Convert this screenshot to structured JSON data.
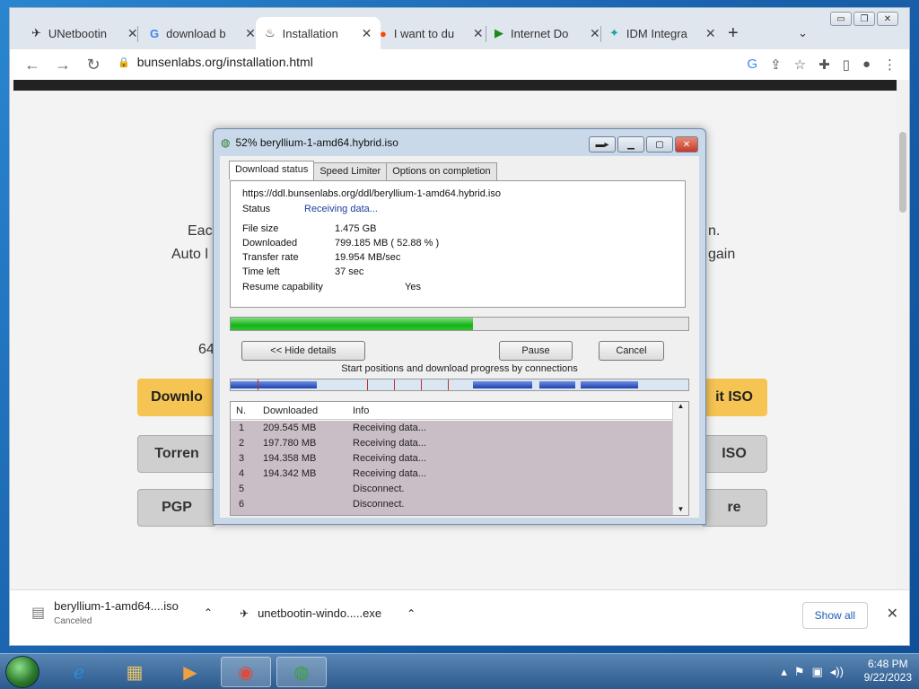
{
  "browser": {
    "tabs": [
      {
        "title": "UNetbootin",
        "icon": "unetbootin-icon"
      },
      {
        "title": "download b",
        "icon": "google-icon"
      },
      {
        "title": "Installation",
        "icon": "bunsenlabs-icon"
      },
      {
        "title": "I want to du",
        "icon": "reddit-icon"
      },
      {
        "title": "Internet Do",
        "icon": "play-icon"
      },
      {
        "title": "IDM Integra",
        "icon": "idm-integration-icon"
      }
    ],
    "url": "bunsenlabs.org/installation.html"
  },
  "page": {
    "text_left_1": "Eac",
    "text_right_1": "n.",
    "text_left_2": "Auto l",
    "text_right_2": "gain",
    "text_64": "64",
    "btn_download_left": "Downlo",
    "btn_download_right": "it ISO",
    "btn_torrent_left": "Torren",
    "btn_torrent_right": "ISO",
    "btn_pgp_left": "PGP",
    "btn_pgp_right": "re"
  },
  "idm": {
    "title": "52% beryllium-1-amd64.hybrid.iso",
    "tabs": [
      "Download status",
      "Speed Limiter",
      "Options on completion"
    ],
    "url": "https://ddl.bunsenlabs.org/ddl/beryllium-1-amd64.hybrid.iso",
    "status_label": "Status",
    "status_value": "Receiving data...",
    "file_size_label": "File size",
    "file_size": "1.475  GB",
    "downloaded_label": "Downloaded",
    "downloaded": "799.185  MB  ( 52.88 % )",
    "transfer_rate_label": "Transfer rate",
    "transfer_rate": "19.954  MB/sec",
    "time_left_label": "Time left",
    "time_left": "37 sec",
    "resume_label": "Resume capability",
    "resume": "Yes",
    "progress_fraction": 0.5288,
    "hide_details": "<< Hide details",
    "pause": "Pause",
    "cancel": "Cancel",
    "connections_label": "Start positions and download progress by connections",
    "columns": [
      "N.",
      "Downloaded",
      "Info"
    ],
    "rows": [
      {
        "n": "1",
        "downloaded": "209.545  MB",
        "info": "Receiving data..."
      },
      {
        "n": "2",
        "downloaded": "197.780  MB",
        "info": "Receiving data..."
      },
      {
        "n": "3",
        "downloaded": "194.358  MB",
        "info": "Receiving data..."
      },
      {
        "n": "4",
        "downloaded": "194.342  MB",
        "info": "Receiving data..."
      },
      {
        "n": "5",
        "downloaded": "",
        "info": "Disconnect."
      },
      {
        "n": "6",
        "downloaded": "",
        "info": "Disconnect."
      }
    ]
  },
  "downloads": [
    {
      "name": "beryllium-1-amd64....iso",
      "status": "Canceled"
    },
    {
      "name": "unetbootin-windo.....exe",
      "status": ""
    }
  ],
  "downloads_show_all": "Show all",
  "taskbar": {
    "time": "6:48 PM",
    "date": "9/22/2023"
  }
}
